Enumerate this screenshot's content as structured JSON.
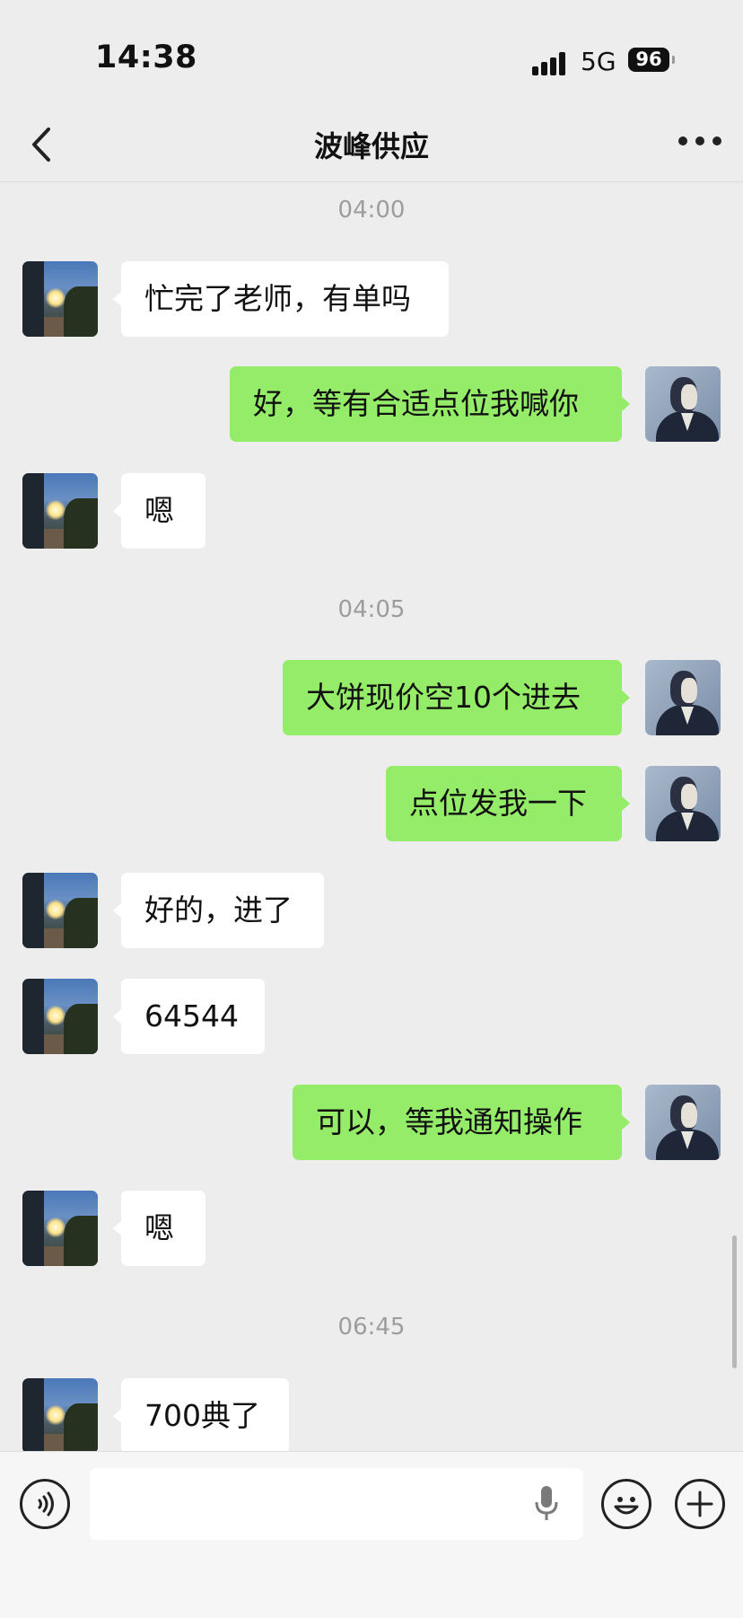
{
  "status": {
    "time": "14:38",
    "network": "5G",
    "battery": "96"
  },
  "header": {
    "title": "波峰供应"
  },
  "timestamps": [
    "04:00",
    "04:05",
    "06:45"
  ],
  "messages": [
    {
      "side": "in",
      "text": "忙完了老师，有单吗"
    },
    {
      "side": "out",
      "text": "好，等有合适点位我喊你"
    },
    {
      "side": "in",
      "text": "嗯"
    },
    {
      "side": "out",
      "text": "大饼现价空10个进去"
    },
    {
      "side": "out",
      "text": "点位发我一下"
    },
    {
      "side": "in",
      "text": "好的，进了"
    },
    {
      "side": "in",
      "text": "64544"
    },
    {
      "side": "out",
      "text": "可以，等我通知操作"
    },
    {
      "side": "in",
      "text": "嗯"
    },
    {
      "side": "in",
      "text": "700典了"
    }
  ],
  "input": {
    "value": ""
  },
  "icons": {
    "back": "chevron-left-icon",
    "more": "more-horizontal-icon",
    "voice": "voice-icon",
    "mic": "mic-icon",
    "emoji": "emoji-icon",
    "plus": "plus-icon"
  },
  "colors": {
    "outgoing_bubble": "#95ec69",
    "incoming_bubble": "#ffffff",
    "background": "#ededed"
  }
}
